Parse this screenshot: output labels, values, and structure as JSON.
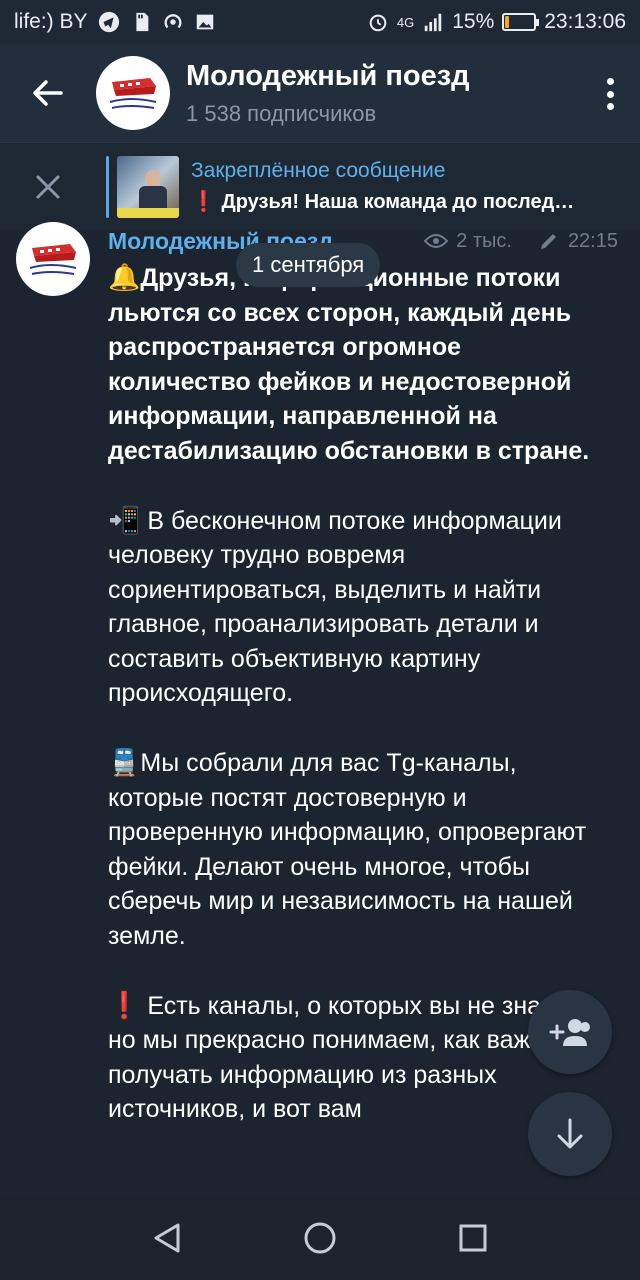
{
  "status_bar": {
    "carrier": "life:) BY",
    "network": "4G",
    "battery_percent": "15%",
    "battery_level": 0.15,
    "time": "23:13:06",
    "icons": [
      "telegram-icon",
      "sd-card-icon",
      "hotspot-icon",
      "image-icon",
      "alarm-icon",
      "signal-icon",
      "battery-icon"
    ]
  },
  "header": {
    "title": "Молодежный поезд",
    "subscribers": "1 538 подписчиков",
    "back_icon": "arrow-left-icon",
    "menu_icon": "more-vertical-icon"
  },
  "pinned": {
    "label": "Закреплённое сообщение",
    "message": "Друзья! Наша команда до послед…",
    "prefix_emoji": "❗",
    "close_icon": "close-icon"
  },
  "message": {
    "author": "Молодежный поезд",
    "views": "2 тыс.",
    "time": "22:15",
    "date_pill": "1 сентября",
    "paragraphs": [
      {
        "emoji": "🔔",
        "text": "Друзья, информационные потоки льются со всех сторон, каждый день распространяется огромное количество фейков и недостоверной информации, направленной на дестабилизацию обстановки в стране.",
        "bold": true
      },
      {
        "emoji": "📲",
        "text": "В бесконечном потоке информации человеку трудно вовремя сориентироваться, выделить и найти главное, проанализировать детали и составить объективную картину происходящего.",
        "bold": false
      },
      {
        "emoji": "🚆",
        "text": "Мы собрали для вас Tg-каналы, которые постят достоверную и проверенную информацию, опровергают фейки. Делают очень многое, чтобы сберечь мир и независимость на нашей земле.",
        "bold": false
      },
      {
        "emoji": "❗",
        "text": "Есть каналы, о которых вы не знаете, но мы прекрасно понимаем, как важно получать информацию из разных источников, и вот вам",
        "bold": false
      }
    ]
  },
  "fabs": {
    "add_icon": "add-user-icon",
    "down_icon": "arrow-down-icon"
  },
  "nav": {
    "back": "nav-back-icon",
    "home": "nav-home-icon",
    "recents": "nav-recents-icon"
  },
  "colors": {
    "background": "#1c242f",
    "header": "#232e3c",
    "accent": "#5eb0ec",
    "battery": "#f5a623",
    "alert": "#e53935"
  }
}
